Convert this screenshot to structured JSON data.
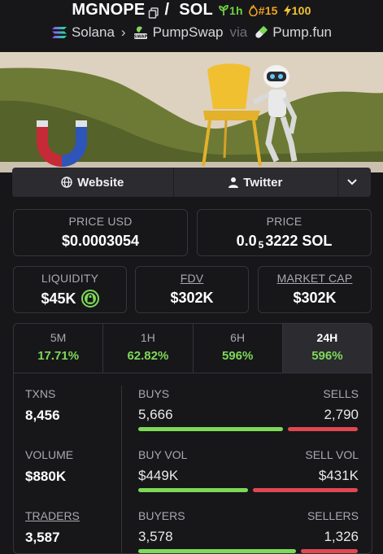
{
  "header": {
    "symbol": "MGNOPE",
    "separator": "/",
    "quote": "SOL",
    "age_badge": "1h",
    "rank_badge": "#15",
    "boost_badge": "100",
    "chain": "Solana",
    "dex": "PumpSwap",
    "via": "via",
    "launchpad": "Pump.fun"
  },
  "links": {
    "website": "Website",
    "twitter": "Twitter"
  },
  "price": {
    "usd_label": "PRICE USD",
    "usd_value": "$0.0003054",
    "native_label": "PRICE",
    "native_prefix": "0.0",
    "native_zero_count": "5",
    "native_suffix": "3222 SOL"
  },
  "stats": {
    "liquidity_label": "LIQUIDITY",
    "liquidity_value": "$45K",
    "fdv_label": "FDV",
    "fdv_value": "$302K",
    "mcap_label": "MARKET CAP",
    "mcap_value": "$302K"
  },
  "timeframes": [
    {
      "label": "5M",
      "change": "17.71%"
    },
    {
      "label": "1H",
      "change": "62.82%"
    },
    {
      "label": "6H",
      "change": "596%"
    },
    {
      "label": "24H",
      "change": "596%"
    }
  ],
  "active_timeframe": "24H",
  "metrics": {
    "txns_label": "TXNS",
    "txns_value": "8,456",
    "buys_label": "BUYS",
    "buys_value": "5,666",
    "sells_label": "SELLS",
    "sells_value": "2,790",
    "volume_label": "VOLUME",
    "volume_value": "$880K",
    "buy_vol_label": "BUY VOL",
    "buy_vol_value": "$449K",
    "sell_vol_label": "SELL VOL",
    "sell_vol_value": "$431K",
    "traders_label": "TRADERS",
    "traders_value": "3,587",
    "buyers_label": "BUYERS",
    "buyers_value": "3,578",
    "sellers_label": "SELLERS",
    "sellers_value": "1,326"
  },
  "ratios": {
    "txns_buy_fraction": 0.67,
    "volume_buy_fraction": 0.51,
    "traders_buy_fraction": 0.73
  },
  "colors": {
    "positive": "#7ed957",
    "negative": "#e0484f",
    "background": "#17171a"
  }
}
